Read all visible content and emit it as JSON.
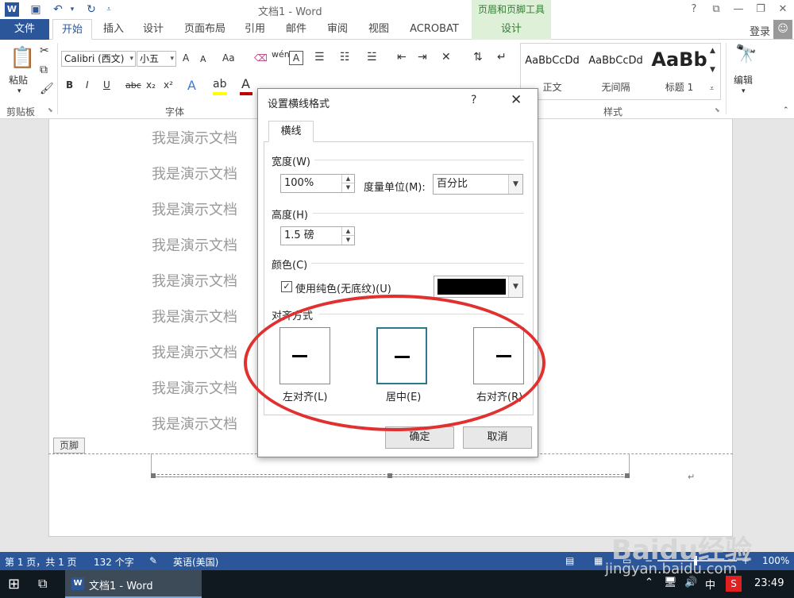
{
  "titlebar": {
    "app_logo": "W",
    "title": "文档1 - Word",
    "context_tab_title": "页眉和页脚工具",
    "help": "?",
    "icons": [
      "save-icon",
      "undo-icon",
      "redo-icon",
      "customize-icon",
      "help-icon",
      "ribbon-display-icon",
      "minimize-icon",
      "maximize-icon",
      "close-icon"
    ]
  },
  "tabs": {
    "file": "文件",
    "items": [
      "开始",
      "插入",
      "设计",
      "页面布局",
      "引用",
      "邮件",
      "审阅",
      "视图",
      "ACROBAT",
      "设计"
    ],
    "login": "登录"
  },
  "ribbon": {
    "clipboard": {
      "paste": "粘贴",
      "label": "剪贴板"
    },
    "font": {
      "family": "Calibri (西文)",
      "size": "小五",
      "label": "字体",
      "bold": "B",
      "italic": "I",
      "underline": "U",
      "strike": "abc",
      "sub": "x₂",
      "sup": "x²",
      "grow": "A",
      "shrink": "A",
      "case": "Aa",
      "colors": {
        "highlight": "#ffff00",
        "font": "#c00000"
      }
    },
    "styles": {
      "items": [
        {
          "sample": "AaBbCcDd",
          "name": "正文"
        },
        {
          "sample": "AaBbCcDd",
          "name": "无间隔"
        },
        {
          "sample": "AaBb",
          "name": "标题 1"
        }
      ],
      "label": "样式"
    },
    "editing": {
      "label": "编辑"
    }
  },
  "document": {
    "lines": [
      "我是演示文档",
      "我是演示文档",
      "我是演示文档",
      "我是演示文档",
      "我是演示文档",
      "我是演示文档",
      "我是演示文档",
      "我是演示文档",
      "我是演示文档"
    ],
    "footer_tag": "页脚",
    "para_mark": "↵"
  },
  "dialog": {
    "title": "设置横线格式",
    "help": "?",
    "close": "✕",
    "tab": "横线",
    "width": {
      "label": "宽度(W)",
      "value": "100%"
    },
    "unit": {
      "label": "度量单位(M):",
      "value": "百分比"
    },
    "height": {
      "label": "高度(H)",
      "value": "1.5 磅"
    },
    "color": {
      "label": "颜色(C)",
      "checkbox": "使用纯色(无底纹)(U)",
      "checked": true,
      "swatch": "#000000"
    },
    "align": {
      "label": "对齐方式",
      "options": [
        "左对齐(L)",
        "居中(E)",
        "右对齐(R)"
      ],
      "selected": "居中(E)"
    },
    "ok": "确定",
    "cancel": "取消"
  },
  "statusbar": {
    "page": "第 1 页，共 1 页",
    "words": "132 个字",
    "language": "英语(美国)",
    "zoom": "100%"
  },
  "taskbar": {
    "app": "文档1 - Word",
    "ime": "中",
    "time": "23:49"
  },
  "watermark": {
    "brand": "Baidu经验",
    "url": "jingyan.baidu.com"
  }
}
